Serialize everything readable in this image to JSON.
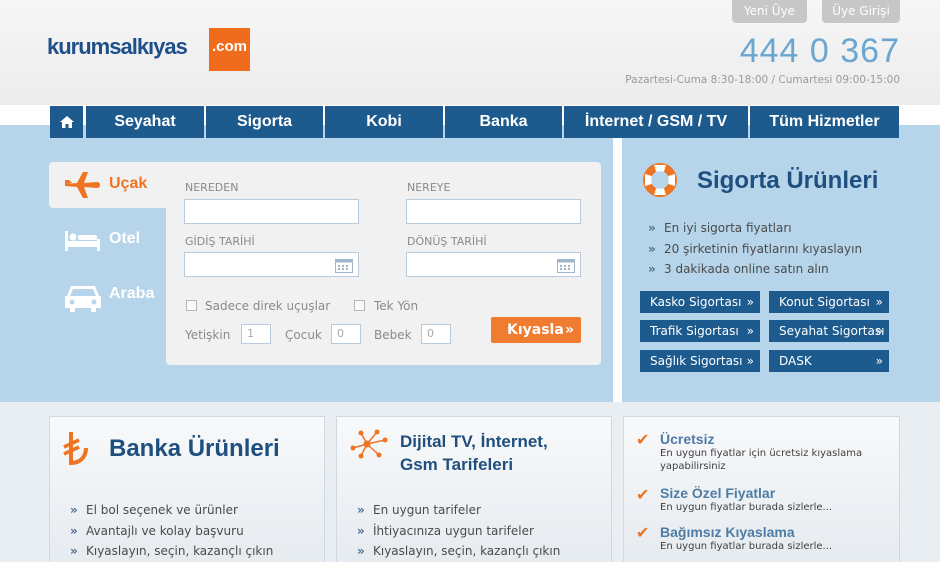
{
  "header": {
    "top_links": [
      "Yeni Üye",
      "Üye Girişi"
    ],
    "logo_text": "kurumsalkıyas",
    "logo_badge": ".com",
    "phone": "444 0 367",
    "hours": "Pazartesi-Cuma 8:30-18:00 / Cumartesi 09:00-15:00"
  },
  "nav": {
    "items": [
      "Seyahat",
      "Sigorta",
      "Kobi",
      "Banka",
      "İnternet / GSM / TV",
      "Tüm Hizmetler"
    ]
  },
  "tabs": [
    "Uçak",
    "Otel",
    "Araba"
  ],
  "search": {
    "from_label": "NEREDEN",
    "to_label": "NEREYE",
    "depart_label": "GİDİŞ TARİHİ",
    "return_label": "DÖNÜŞ TARİHİ",
    "direct_label": "Sadece direk uçuşlar",
    "oneway_label": "Tek Yön",
    "adult_label": "Yetişkin",
    "adult_value": "1",
    "child_label": "Çocuk",
    "child_value": "0",
    "infant_label": "Bebek",
    "infant_value": "0",
    "compare_label": "Kıyasla",
    "compare_chev": "»"
  },
  "insurance": {
    "title": "Sigorta Ürünleri",
    "bullets": [
      "En iyi sigorta fiyatları",
      "20 şirketinin fiyatlarını kıyaslayın",
      "3 dakikada online satın alın"
    ],
    "buttons": [
      "Kasko Sigortası",
      "Konut Sigortası",
      "Trafik Sigortası",
      "Seyahat Sigortası",
      "Sağlık Sigortası",
      "DASK"
    ],
    "chev": "»"
  },
  "bank": {
    "title": "Banka Ürünleri",
    "bullets": [
      "El bol seçenek ve ürünler",
      "Avantajlı ve kolay başvuru",
      "Kıyaslayın, seçin, kazançlı çıkın"
    ]
  },
  "tv": {
    "title_line1": "Dijital TV, İnternet,",
    "title_line2": "Gsm Tarifeleri",
    "bullets": [
      "En uygun tarifeler",
      "İhtiyacınıza uygun tarifeler",
      "Kıyaslayın, seçin, kazançlı çıkın"
    ]
  },
  "features": [
    {
      "title": "Ücretsiz",
      "desc": "En uygun fiyatlar için ücretsiz kıyaslama yapabilirsiniz"
    },
    {
      "title": "Size Özel Fiyatlar",
      "desc": "En uygun fiyatlar burada sizlerle..."
    },
    {
      "title": "Bağımsız Kıyaslama",
      "desc": "En uygun fiyatlar burada sizlerle..."
    }
  ],
  "colors": {
    "brand_blue": "#1d5a8e",
    "accent_orange": "#ef7422",
    "band_blue": "#b6d5ea"
  }
}
